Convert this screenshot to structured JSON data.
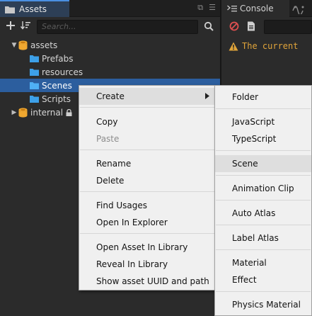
{
  "assets_panel": {
    "tab_label": "Assets",
    "tab_actions": [
      "⧉",
      "☰"
    ],
    "search_placeholder": "Search...",
    "tree": [
      {
        "label": "assets",
        "type": "db",
        "expanded": true
      },
      {
        "label": "Prefabs",
        "type": "folder"
      },
      {
        "label": "resources",
        "type": "folder"
      },
      {
        "label": "Scenes",
        "type": "folder",
        "selected": true
      },
      {
        "label": "Scripts",
        "type": "folder"
      },
      {
        "label": "internal",
        "type": "db",
        "expanded": false,
        "locked": true
      }
    ]
  },
  "console_panel": {
    "tab_label": "Console",
    "message": "The current"
  },
  "context_menu": {
    "items": [
      {
        "label": "Create",
        "has_submenu": true,
        "highlighted": true
      },
      {
        "label": "Copy"
      },
      {
        "label": "Paste",
        "disabled": true
      },
      {
        "label": "Rename"
      },
      {
        "label": "Delete"
      },
      {
        "label": "Find Usages"
      },
      {
        "label": "Open In Explorer"
      },
      {
        "label": "Open Asset In Library"
      },
      {
        "label": "Reveal In Library"
      },
      {
        "label": "Show asset UUID and path"
      }
    ]
  },
  "create_submenu": {
    "items": [
      {
        "label": "Folder"
      },
      {
        "label": "JavaScript"
      },
      {
        "label": "TypeScript"
      },
      {
        "label": "Scene",
        "highlighted": true
      },
      {
        "label": "Animation Clip"
      },
      {
        "label": "Auto Atlas"
      },
      {
        "label": "Label Atlas"
      },
      {
        "label": "Material"
      },
      {
        "label": "Effect"
      },
      {
        "label": "Physics Material"
      }
    ]
  },
  "colors": {
    "selection": "#2c5e9e",
    "warning_text": "#e0a43a",
    "db_icon": "#f0a830",
    "folder_icon": "#3da0e8",
    "menu_bg": "#f0f0f0"
  }
}
